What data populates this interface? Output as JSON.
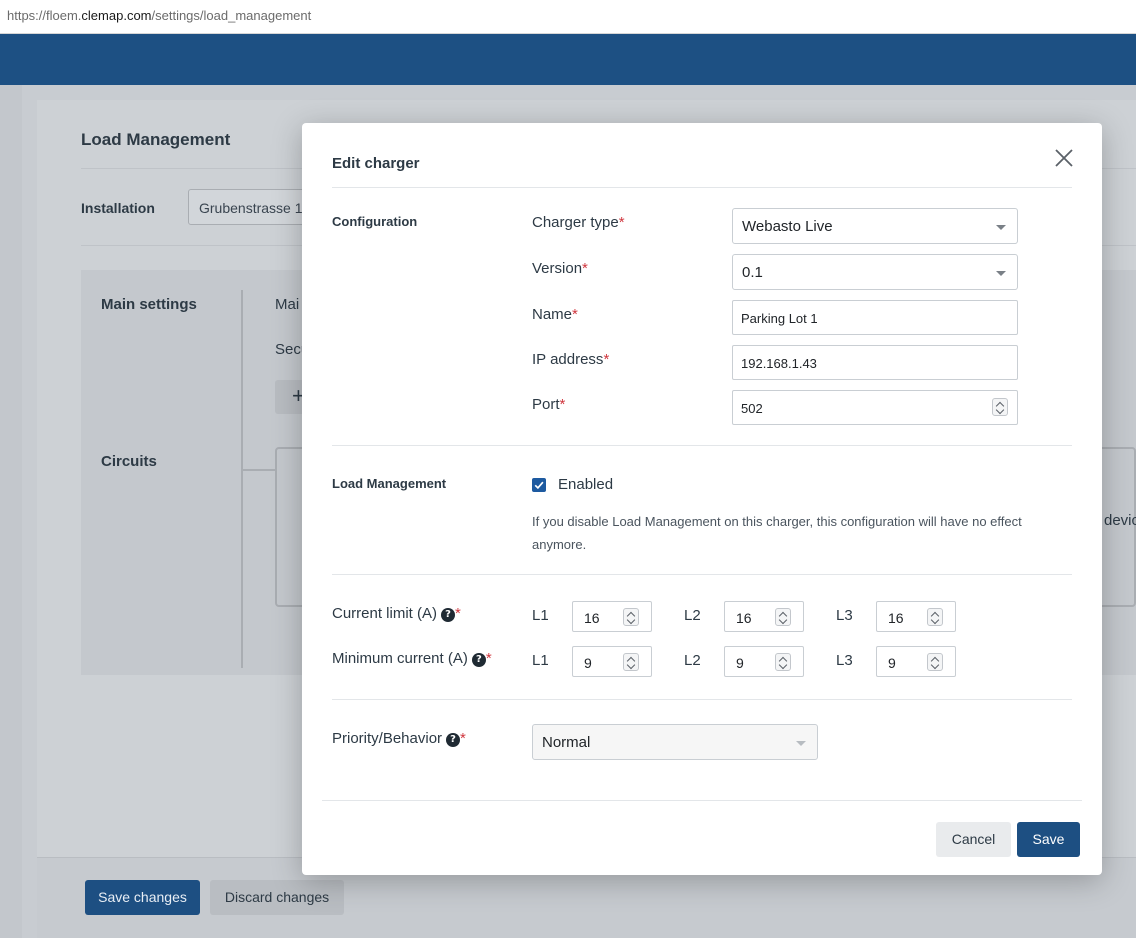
{
  "browser": {
    "url_prefix": "https://floem.",
    "url_domain": "clemap.com",
    "url_path": "/settings/load_management"
  },
  "background": {
    "title": "Load Management",
    "installation_label": "Installation",
    "installation_value": "Grubenstrasse 1",
    "main_settings_label": "Main settings",
    "circuits_label": "Circuits",
    "main_partial": "Mai",
    "secu_partial": "Secu",
    "plus_icon": "+",
    "devic_partial": "devic",
    "save_changes": "Save changes",
    "discard_changes": "Discard changes"
  },
  "modal": {
    "title": "Edit charger",
    "configuration_label": "Configuration",
    "charger_type_label": "Charger type",
    "charger_type_value": "Webasto Live",
    "version_label": "Version",
    "version_value": "0.1",
    "name_label": "Name",
    "name_value": "Parking Lot 1",
    "ip_label": "IP address",
    "ip_value": "192.168.1.43",
    "port_label": "Port",
    "port_value": "502",
    "required_mark": "*",
    "load_management_label": "Load Management",
    "enabled_label": "Enabled",
    "enabled_checked": true,
    "load_management_help": "If you disable Load Management on this charger, this configuration will have no effect anymore.",
    "current_limit_label": "Current limit (A)",
    "minimum_current_label": "Minimum current (A)",
    "help_icon": "?",
    "phases": [
      "L1",
      "L2",
      "L3"
    ],
    "current_limit_values": [
      "16",
      "16",
      "16"
    ],
    "minimum_current_values": [
      "9",
      "9",
      "9"
    ],
    "priority_label": "Priority/Behavior",
    "priority_value": "Normal",
    "cancel_label": "Cancel",
    "save_label": "Save"
  },
  "colors": {
    "header": "#1d5083",
    "primary_button": "#1d4f82",
    "required": "#d0373f",
    "checkbox": "#1d5aa0"
  },
  "icons": {
    "close": "close-icon",
    "help": "question-circle-icon",
    "caret": "chevron-down-icon",
    "spinner": "spinner-arrows-icon",
    "checkbox": "checkmark-icon"
  }
}
